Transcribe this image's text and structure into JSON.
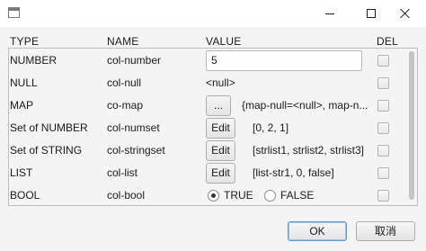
{
  "window": {
    "app_icon": "window-icon",
    "controls": [
      "minimize-icon",
      "maximize-icon",
      "close-icon"
    ]
  },
  "headers": {
    "type": "TYPE",
    "name": "NAME",
    "value": "VALUE",
    "del": "DEL"
  },
  "rows": [
    {
      "type": "NUMBER",
      "name": "col-number",
      "value": "5",
      "widget": "text-field",
      "del": false
    },
    {
      "type": "NULL",
      "name": "col-null",
      "value": "<null>",
      "widget": "label",
      "del": false
    },
    {
      "type": "MAP",
      "name": "co-map",
      "button": "...",
      "value": "{map-null=<null>, map-n...",
      "widget": "button",
      "del": false
    },
    {
      "type": "Set of NUMBER",
      "name": "col-numset",
      "button": "Edit",
      "value": "[0, 2, 1]",
      "widget": "button",
      "del": false
    },
    {
      "type": "Set of STRING",
      "name": "col-stringset",
      "button": "Edit",
      "value": "[strlist1, strlist2, strlist3]",
      "widget": "button",
      "del": false
    },
    {
      "type": "LIST",
      "name": "col-list",
      "button": "Edit",
      "value": "[list-str1, 0, false]",
      "widget": "button",
      "del": false
    },
    {
      "type": "BOOL",
      "name": "col-bool",
      "widget": "radio",
      "options": [
        "TRUE",
        "FALSE"
      ],
      "selected": "TRUE",
      "del": false
    }
  ],
  "footer": {
    "ok_label": "OK",
    "cancel_label": "取消"
  },
  "colors": {
    "default_button_border": "#5b9bd5",
    "background": "#f4f4f4"
  }
}
